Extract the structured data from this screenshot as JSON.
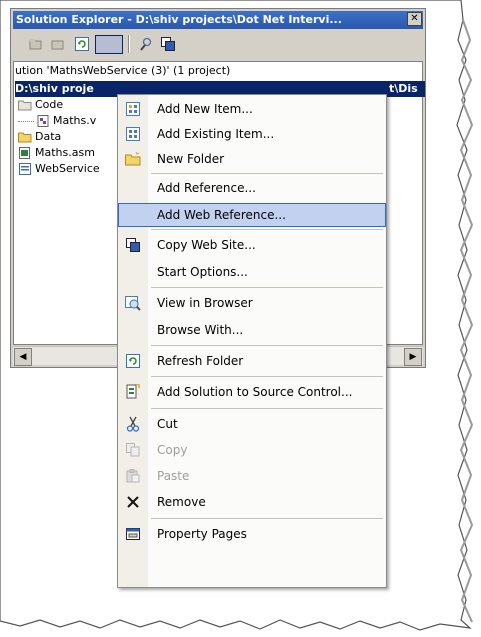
{
  "window": {
    "title": "Solution Explorer - D:\\shiv projects\\Dot Net Intervi...",
    "close_label": "✕"
  },
  "tree": {
    "solution": "ution 'MathsWebService (3)' (1 project)",
    "project_left": "D:\\shiv proje",
    "project_right": "t\\Dis",
    "items": [
      {
        "label": "Code"
      },
      {
        "label": "Maths.v"
      },
      {
        "label": "Data"
      },
      {
        "label": "Maths.asm"
      },
      {
        "label": "WebService"
      }
    ]
  },
  "context_menu": {
    "items": [
      {
        "label": "Add New Item...",
        "icon": "add-new-item-icon"
      },
      {
        "label": "Add Existing Item...",
        "icon": "add-existing-item-icon"
      },
      {
        "label": "New Folder",
        "icon": "folder-icon"
      },
      {
        "label": "Add Reference...",
        "icon": ""
      },
      {
        "label": "Add Web Reference...",
        "icon": "",
        "selected": true
      },
      {
        "label": "Copy Web Site...",
        "icon": "copy-web-site-icon"
      },
      {
        "label": "Start Options...",
        "icon": ""
      },
      {
        "label": "View in Browser",
        "icon": "view-in-browser-icon"
      },
      {
        "label": "Browse With...",
        "icon": ""
      },
      {
        "label": "Refresh Folder",
        "icon": "refresh-icon"
      },
      {
        "label": "Add Solution to Source Control...",
        "icon": "source-control-icon"
      },
      {
        "label": "Cut",
        "icon": "cut-icon"
      },
      {
        "label": "Copy",
        "icon": "copy-icon",
        "disabled": true
      },
      {
        "label": "Paste",
        "icon": "paste-icon",
        "disabled": true
      },
      {
        "label": "Remove",
        "icon": "remove-icon"
      },
      {
        "label": "Property Pages",
        "icon": "property-pages-icon"
      }
    ]
  },
  "colors": {
    "title_bar": "#2a58ad",
    "selection": "#c2d1ef",
    "selection_border": "#316ac5",
    "tree_highlight": "#0a246a"
  }
}
